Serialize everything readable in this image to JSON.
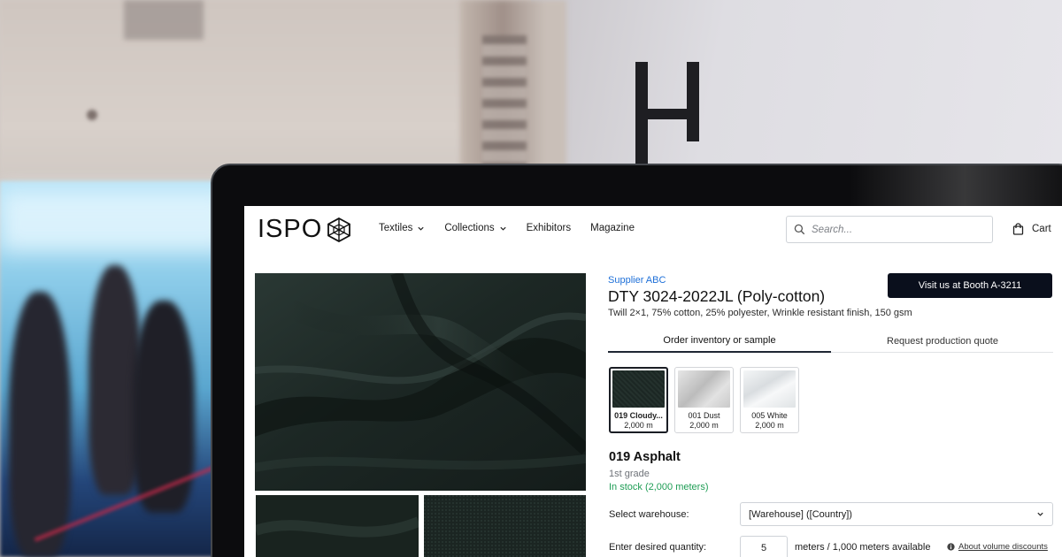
{
  "header": {
    "logo_text": "ISPO",
    "nav": [
      {
        "label": "Textiles",
        "has_dropdown": true
      },
      {
        "label": "Collections",
        "has_dropdown": true
      },
      {
        "label": "Exhibitors",
        "has_dropdown": false
      },
      {
        "label": "Magazine",
        "has_dropdown": false
      }
    ],
    "search_placeholder": "Search...",
    "cart_label": "Cart"
  },
  "product": {
    "supplier": "Supplier ABC",
    "booth_button": "Visit us at Booth A-3211",
    "title": "DTY 3024-2022JL (Poly-cotton)",
    "description": "Twill 2×1, 75% cotton, 25% polyester, Wrinkle resistant finish, 150 gsm"
  },
  "tabs": [
    {
      "label": "Order inventory or sample",
      "active": true
    },
    {
      "label": "Request production quote",
      "active": false
    }
  ],
  "swatches": [
    {
      "name": "019 Cloudy...",
      "qty": "2,000 m",
      "selected": true,
      "color": "#1f2b28"
    },
    {
      "name": "001 Dust",
      "qty": "2,000 m",
      "selected": false,
      "color": "#d6d6d6"
    },
    {
      "name": "005 White",
      "qty": "2,000 m",
      "selected": false,
      "color": "#eef0f1"
    }
  ],
  "selection": {
    "color_name": "019 Asphalt",
    "grade": "1st grade",
    "stock": "In stock (2,000 meters)",
    "warehouse_label": "Select warehouse:",
    "warehouse_value": "[Warehouse] ([Country])",
    "quantity_label": "Enter desired quantity:",
    "quantity_value": "5",
    "availability": "meters / 1,000 meters available",
    "volume_link": "About volume discounts"
  },
  "colors": {
    "accent_link": "#1d6fd8",
    "button_dark": "#0a0f1c",
    "stock_green": "#1f9d55"
  }
}
